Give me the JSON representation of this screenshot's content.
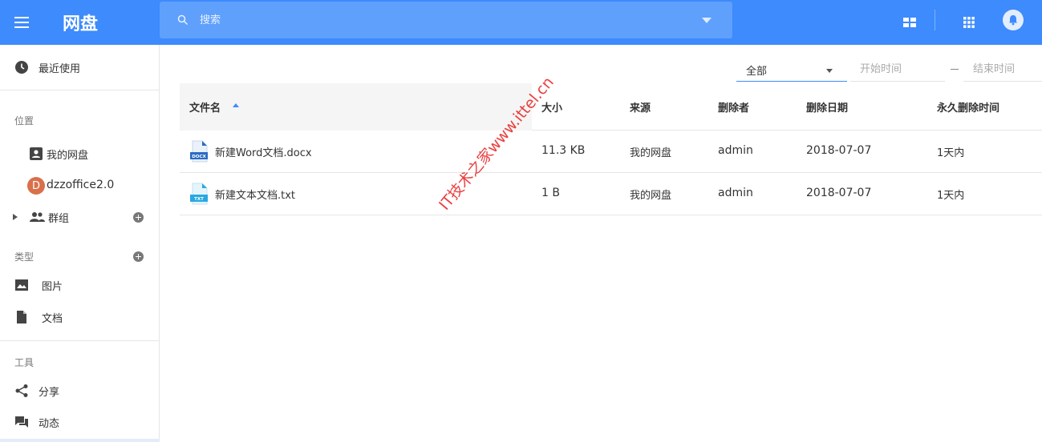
{
  "header": {
    "title": "网盘",
    "search_placeholder": "搜索",
    "icons": [
      "menu-icon",
      "search-icon",
      "dropdown-icon",
      "layout-icon",
      "apps-grid-icon",
      "bell-icon"
    ]
  },
  "sidebar": {
    "recent_label": "最近使用",
    "location_section": "位置",
    "my_drive_label": "我的网盘",
    "org_avatar_letter": "D",
    "org_label": "dzzoffice2.0",
    "groups_label": "群组",
    "types_section": "类型",
    "images_label": "图片",
    "docs_label": "文档",
    "tools_section": "工具",
    "share_label": "分享",
    "activity_label": "动态"
  },
  "filter": {
    "scope_value": "全部",
    "start_placeholder": "开始时间",
    "end_placeholder": "结束时间"
  },
  "table": {
    "headers": {
      "name": "文件名",
      "size": "大小",
      "source": "来源",
      "deleter": "删除者",
      "delete_date": "删除日期",
      "permanent_delete": "永久删除时间"
    },
    "rows": [
      {
        "icon": "docx-file-icon",
        "icon_text": "DOCX",
        "name": "新建Word文档.docx",
        "size": "11.3 KB",
        "source": "我的网盘",
        "deleter": "admin",
        "delete_date": "2018-07-07",
        "permanent_delete": "1天内"
      },
      {
        "icon": "txt-file-icon",
        "icon_text": "TXT",
        "name": "新建文本文档.txt",
        "size": "1 B",
        "source": "我的网盘",
        "deleter": "admin",
        "delete_date": "2018-07-07",
        "permanent_delete": "1天内"
      }
    ]
  },
  "watermark": "IT技术之家www.ittel.cn",
  "colors": {
    "brand_blue": "#3d8bfd",
    "docx_icon": "#2b6cc4",
    "txt_icon": "#29a8e0",
    "watermark_red": "#e61e1e",
    "avatar": "#d9704a"
  }
}
